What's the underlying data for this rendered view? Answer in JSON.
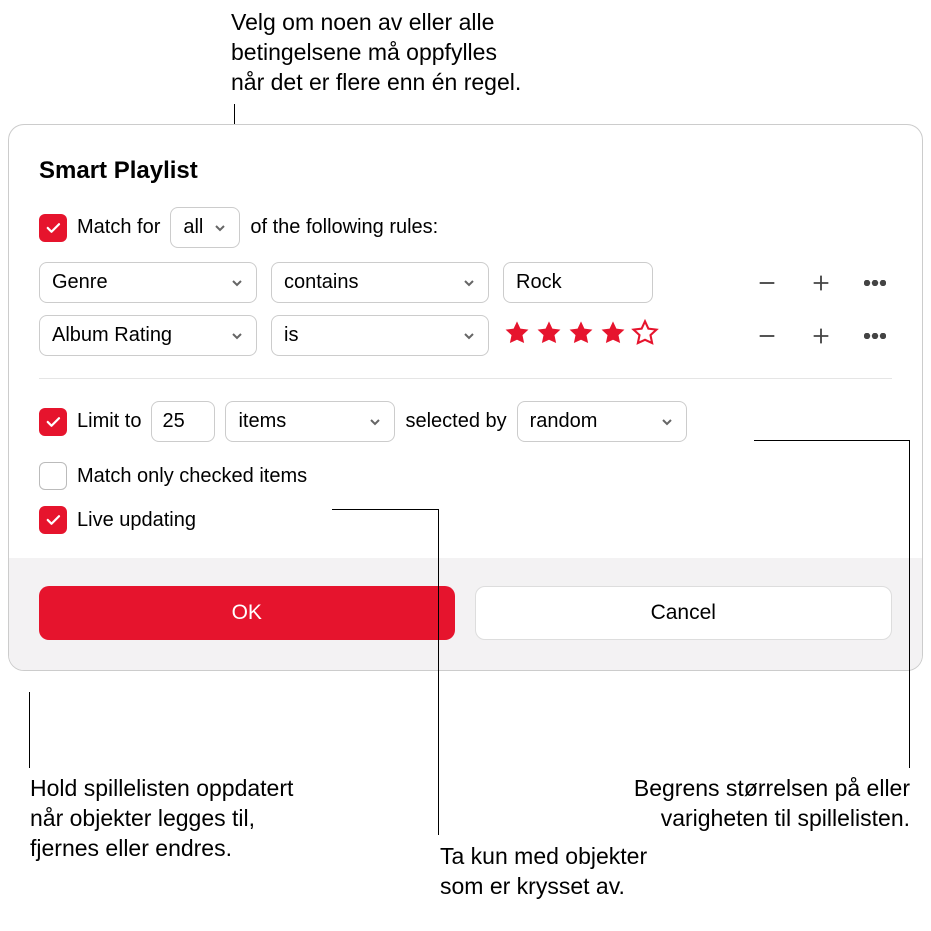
{
  "callouts": {
    "top": "Velg om noen av eller alle\nbetingelsene må oppfylles\nnår det er flere enn én regel.",
    "bottom_left": "Hold spillelisten oppdatert\nnår objekter legges til,\nfjernes eller endres.",
    "bottom_mid": "Ta kun med objekter\nsom er krysset av.",
    "bottom_right": "Begrens størrelsen på eller\nvarigheten til spillelisten."
  },
  "dialog": {
    "title": "Smart Playlist",
    "match_label_prefix": "Match for",
    "match_mode": "all",
    "match_label_suffix": "of the following rules:",
    "rules": [
      {
        "field": "Genre",
        "op": "contains",
        "value": "Rock",
        "value_type": "text"
      },
      {
        "field": "Album Rating",
        "op": "is",
        "value": 4,
        "value_type": "stars"
      }
    ],
    "limit": {
      "label": "Limit to",
      "count": "25",
      "unit": "items",
      "selected_by_label": "selected by",
      "method": "random"
    },
    "match_checked_label": "Match only checked items",
    "live_updating_label": "Live updating",
    "buttons": {
      "ok": "OK",
      "cancel": "Cancel"
    }
  },
  "colors": {
    "accent": "#e6142d"
  }
}
